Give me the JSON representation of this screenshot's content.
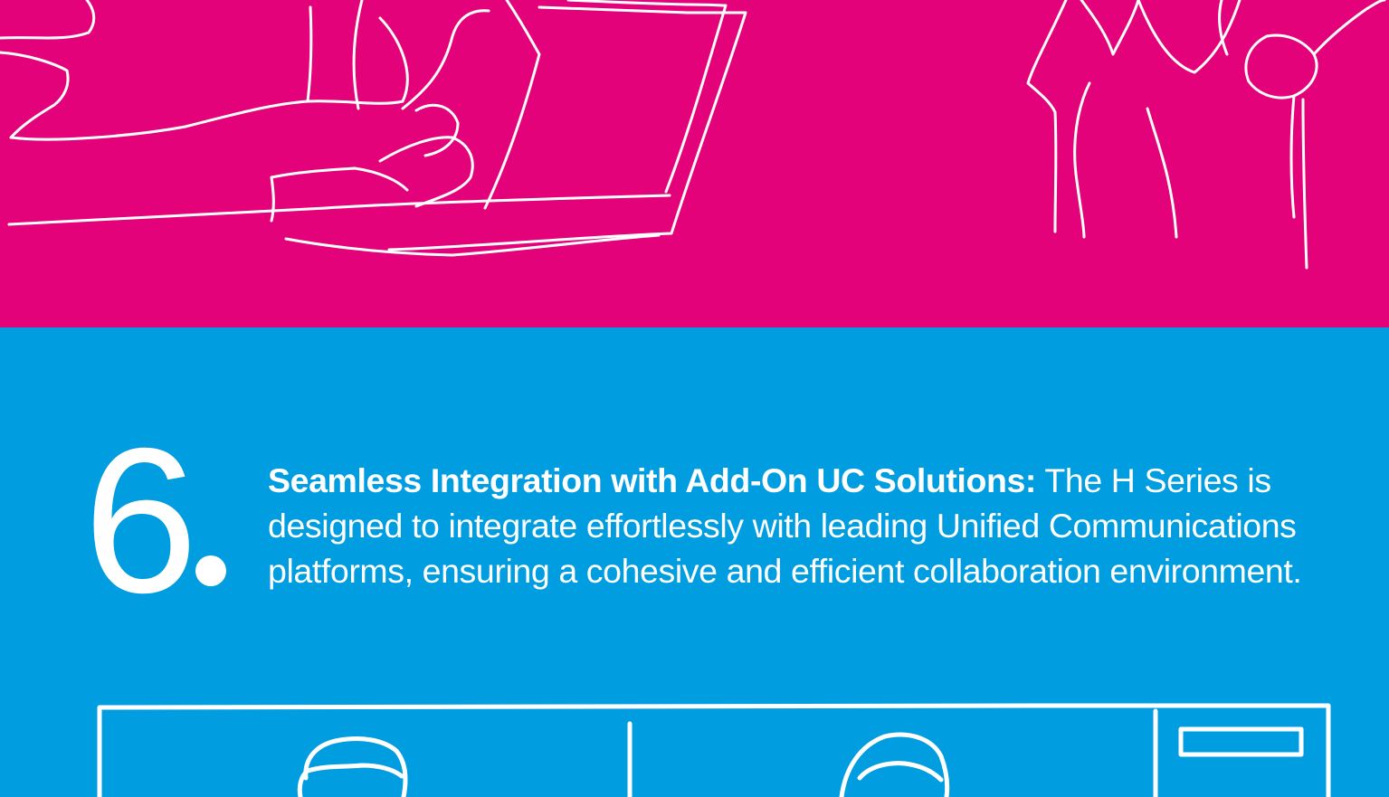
{
  "colors": {
    "pink": "#e4027b",
    "blue": "#009de0",
    "line_art": "#ffffff"
  },
  "illustration_top": {
    "name": "line-art-person-with-laptop"
  },
  "illustration_bottom": {
    "name": "line-art-video-conference-screen"
  },
  "feature": {
    "number": "6",
    "heading": "Seamless Integration with Add-On UC Solutions:",
    "body": "The H Series is designed to integrate effortlessly with leading Unified Communications platforms, ensuring a cohesive and efficient collaboration environment."
  }
}
